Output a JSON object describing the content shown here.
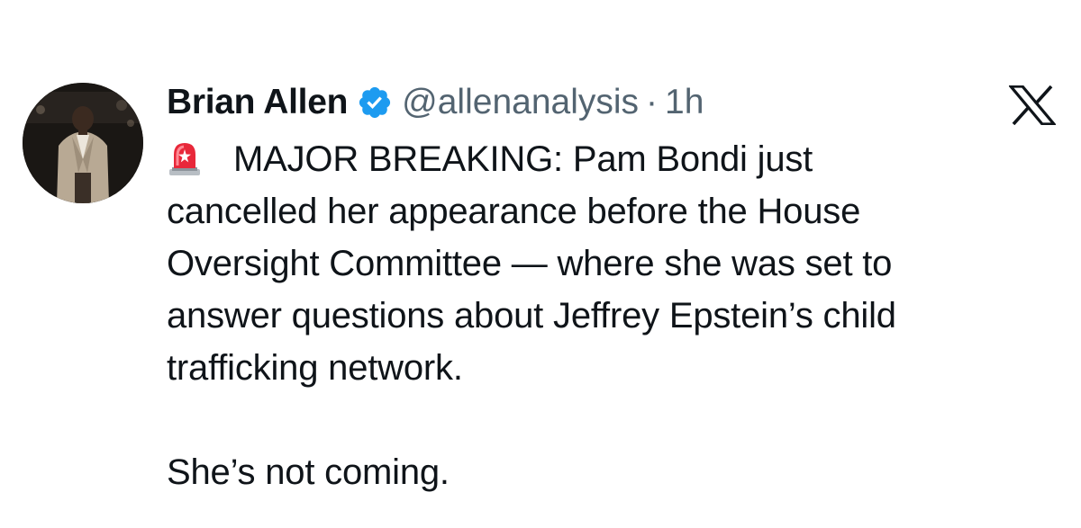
{
  "author": {
    "display_name": "Brian Allen",
    "handle": "@allenanalysis",
    "separator": "·",
    "time": "1h",
    "verified": true
  },
  "tweet": {
    "emoji_icon": "police-car-light-siren",
    "lines": [
      "MAJOR BREAKING: Pam Bondi just",
      "cancelled her appearance before the House",
      "Oversight Committee — where she was set to",
      "answer questions about Jeffrey Epstein’s child",
      "trafficking network."
    ],
    "closing": "She’s not coming."
  },
  "colors": {
    "verified_badge": "#1d9bf0",
    "secondary_text": "#536471",
    "primary_text": "#0f1419"
  }
}
